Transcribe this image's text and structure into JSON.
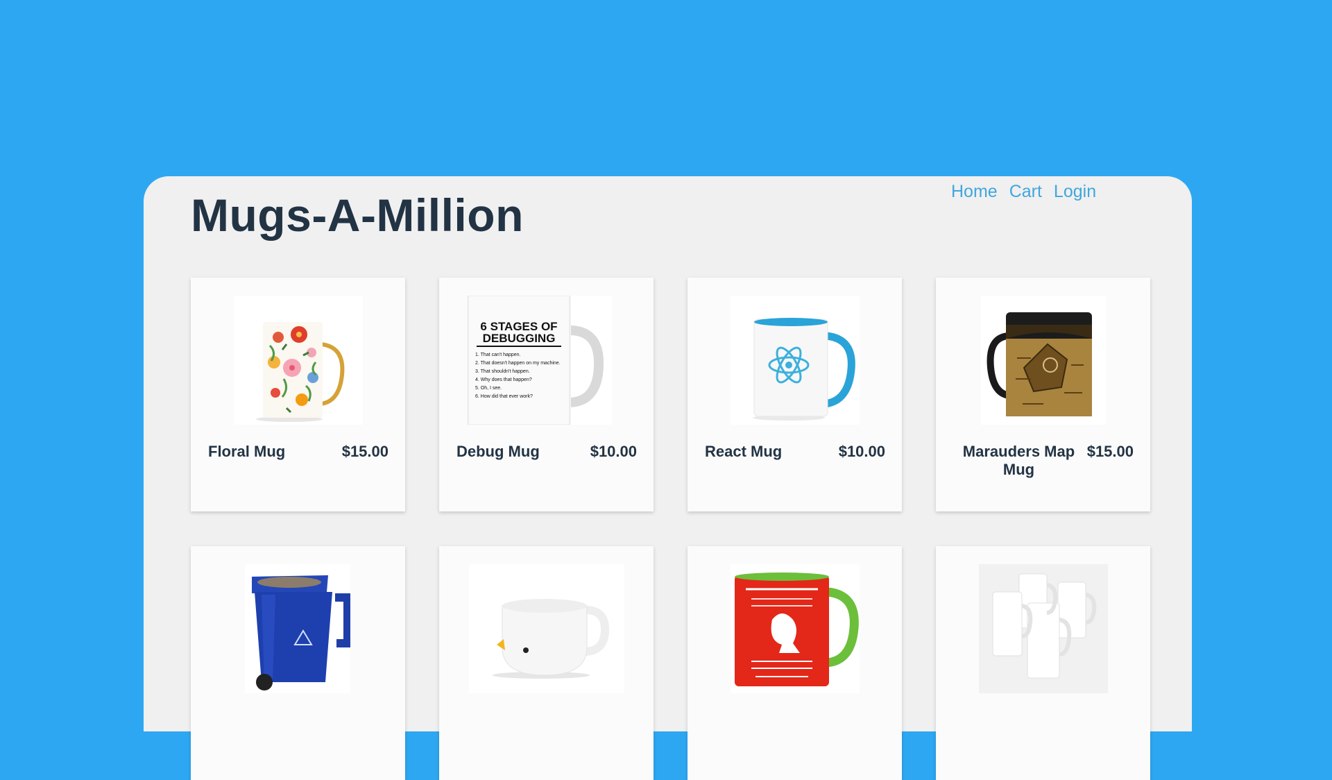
{
  "site": {
    "title": "Mugs-A-Million"
  },
  "nav": {
    "home": "Home",
    "cart": "Cart",
    "login": "Login"
  },
  "products": [
    {
      "name": "Floral Mug",
      "price": "$15.00",
      "image": "floral-mug-image"
    },
    {
      "name": "Debug Mug",
      "price": "$10.00",
      "image": "debug-mug-image",
      "mug_text": {
        "heading_1": "6 STAGES OF",
        "heading_2": "DEBUGGING",
        "lines": [
          "1. That can't happen.",
          "2. That doesn't happen on my machine.",
          "3. That shouldn't happen.",
          "4. Why does that happen?",
          "5. Oh, I see.",
          "6. How did that ever work?"
        ]
      }
    },
    {
      "name": "React Mug",
      "price": "$10.00",
      "image": "react-mug-image"
    },
    {
      "name": "Marauders Map Mug",
      "price": "$15.00",
      "image": "marauders-map-mug-image"
    },
    {
      "name": "",
      "price": "",
      "image": "recycle-bin-mug-image"
    },
    {
      "name": "",
      "price": "",
      "image": "duck-mug-image"
    },
    {
      "name": "",
      "price": "",
      "image": "sriracha-mug-image"
    },
    {
      "name": "",
      "price": "",
      "image": "white-mugs-set-image"
    }
  ],
  "colors": {
    "background": "#2ea7f2",
    "panel": "#f0f0f0",
    "title": "#223344",
    "nav_link": "#41a6dd"
  }
}
